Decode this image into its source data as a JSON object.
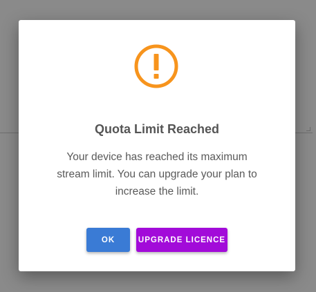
{
  "dialog": {
    "title": "Quota Limit Reached",
    "message": "Your device has reached its maximum stream limit. You can upgrade your plan to increase the limit.",
    "icon": "exclamation-circle-icon",
    "icon_color": "#f7941d",
    "ok_label": "OK",
    "upgrade_label": "UPGRADE LICENCE",
    "ok_color": "#3a7bd5",
    "upgrade_color": "#a20bd9"
  }
}
